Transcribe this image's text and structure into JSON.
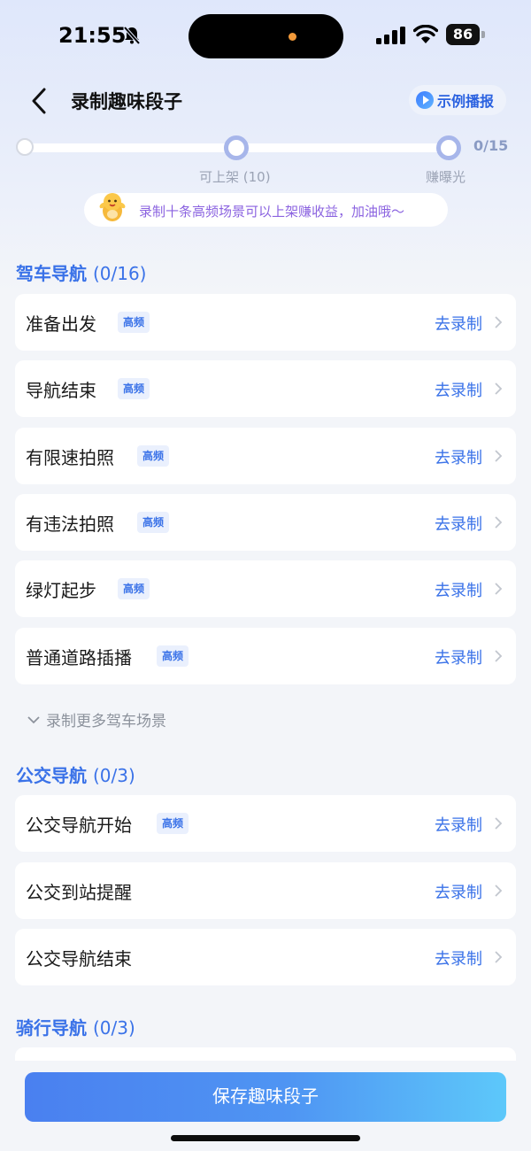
{
  "status_bar": {
    "time": "21:55",
    "battery": "86"
  },
  "nav": {
    "title": "录制趣味段子",
    "demo_label": "示例播报"
  },
  "progress": {
    "count_text": "0/15",
    "recorded": 0,
    "milestones": [
      {
        "label": "可上架 (10)"
      },
      {
        "label": "赚曝光"
      }
    ],
    "tip": "录制十条高频场景可以上架赚收益，加油哦～"
  },
  "sections": [
    {
      "title": "驾车导航",
      "count": "(0/16)",
      "items": [
        {
          "name": "准备出发",
          "badge": "高频",
          "action": "去录制"
        },
        {
          "name": "导航结束",
          "badge": "高频",
          "action": "去录制"
        },
        {
          "name": "有限速拍照",
          "badge": "高频",
          "action": "去录制"
        },
        {
          "name": "有违法拍照",
          "badge": "高频",
          "action": "去录制"
        },
        {
          "name": "绿灯起步",
          "badge": "高频",
          "action": "去录制"
        },
        {
          "name": "普通道路插播",
          "badge": "高频",
          "action": "去录制"
        }
      ],
      "more_label": "录制更多驾车场景"
    },
    {
      "title": "公交导航",
      "count": "(0/3)",
      "items": [
        {
          "name": "公交导航开始",
          "badge": "高频",
          "action": "去录制"
        },
        {
          "name": "公交到站提醒",
          "action": "去录制"
        },
        {
          "name": "公交导航结束",
          "action": "去录制"
        }
      ]
    },
    {
      "title": "骑行导航",
      "count": "(0/3)",
      "items": []
    }
  ],
  "footer": {
    "save_label": "保存趣味段子"
  },
  "colors": {
    "accent": "#3a72e8",
    "tip_text": "#8b63e0",
    "milestone_ring": "#a7b6ea"
  },
  "icons": [
    "bell-muted-icon",
    "signal-icon",
    "wifi-icon",
    "battery-icon",
    "back-arrow-icon",
    "play-icon",
    "mascot-icon",
    "chevron-right-icon",
    "chevron-down-icon"
  ]
}
